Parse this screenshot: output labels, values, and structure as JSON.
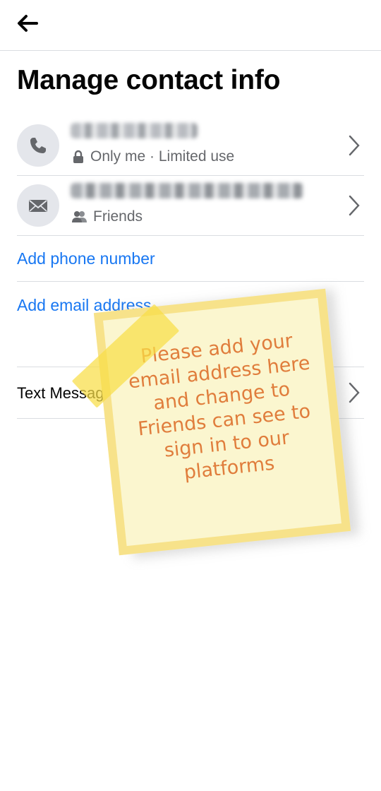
{
  "header": {
    "back_icon": "arrow-left-icon"
  },
  "page": {
    "title": "Manage contact info"
  },
  "contacts": [
    {
      "type": "phone",
      "icon": "phone-icon",
      "value_visible": false,
      "privacy_icon": "lock-icon",
      "privacy_label": "Only me · Limited use",
      "chevron_icon": "chevron-right-icon"
    },
    {
      "type": "email",
      "icon": "envelope-icon",
      "value_visible": false,
      "privacy_icon": "friends-icon",
      "privacy_label": "Friends",
      "chevron_icon": "chevron-right-icon"
    }
  ],
  "actions": {
    "add_phone": "Add phone number",
    "add_email": "Add email address"
  },
  "settings": {
    "text_message_label": "Text Messag"
  },
  "overlay_note": {
    "text": "Please add your\nemail address here\nand change to\nFriends can see to\nsign in to our\nplatforms"
  },
  "colors": {
    "link": "#1877f2",
    "secondary_text": "#65676b",
    "note_text": "#e07d3c",
    "note_tape": "#f8de46"
  }
}
